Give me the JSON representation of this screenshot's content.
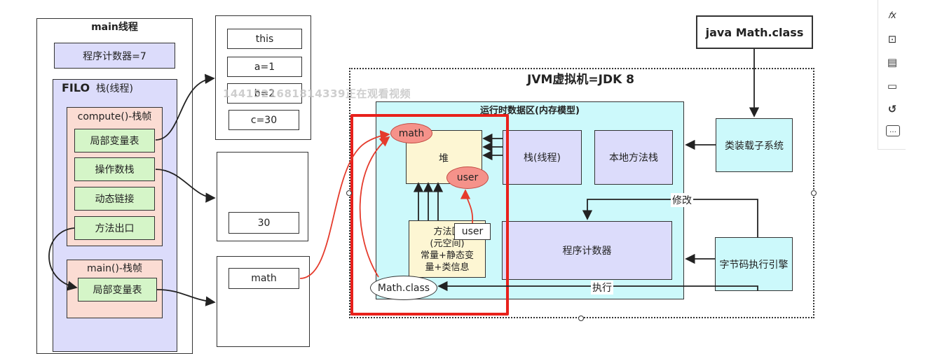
{
  "main_thread": {
    "title": "main线程",
    "pc": "程序计数器=7",
    "filo": "FILO",
    "stack": "栈(线程)",
    "compute_frame": {
      "title": "compute()-栈帧",
      "items": [
        "局部变量表",
        "操作数栈",
        "动态链接",
        "方法出口"
      ]
    },
    "main_frame": {
      "title": "main()-栈帧",
      "items": [
        "局部变量表"
      ]
    }
  },
  "locals_table": [
    "this",
    "a=1",
    "b=2",
    "c=30"
  ],
  "operand_value": "30",
  "main_local": "math",
  "watermark": "1441521681814339正在观看视频",
  "jvm": {
    "title": "JVM虚拟机=JDK 8",
    "runtime_area": "运行时数据区(内存模型)",
    "heap": "堆",
    "heap_objects": [
      "math",
      "user"
    ],
    "stack": "栈(线程)",
    "native_stack": "本地方法栈",
    "method_area": "方法区\n(元空间)\n常量+静态变\n量+类信息",
    "method_area_tag": "user",
    "pc": "程序计数器",
    "class_oval": "Math.class",
    "class_loader": "类装载子系统",
    "engine": "字节码执行引擎",
    "modify_label": "修改",
    "execute_label": "执行"
  },
  "java_cmd": "java Math.class",
  "toolbar": {
    "icons": [
      "formula-icon",
      "resize-icon",
      "pages-icon",
      "file-icon",
      "history-icon",
      "comment-icon"
    ],
    "glyphs": [
      "𝑓x",
      "⊡",
      "▤",
      "▭",
      "↺",
      "…"
    ]
  },
  "colors": {
    "green": "#d5f5c8",
    "lavender": "#dcdcfb",
    "pink": "#fbdcd3",
    "cyan": "#ccf9fb",
    "cream": "#fdf6d3",
    "highlight_red": "#e8211c"
  }
}
